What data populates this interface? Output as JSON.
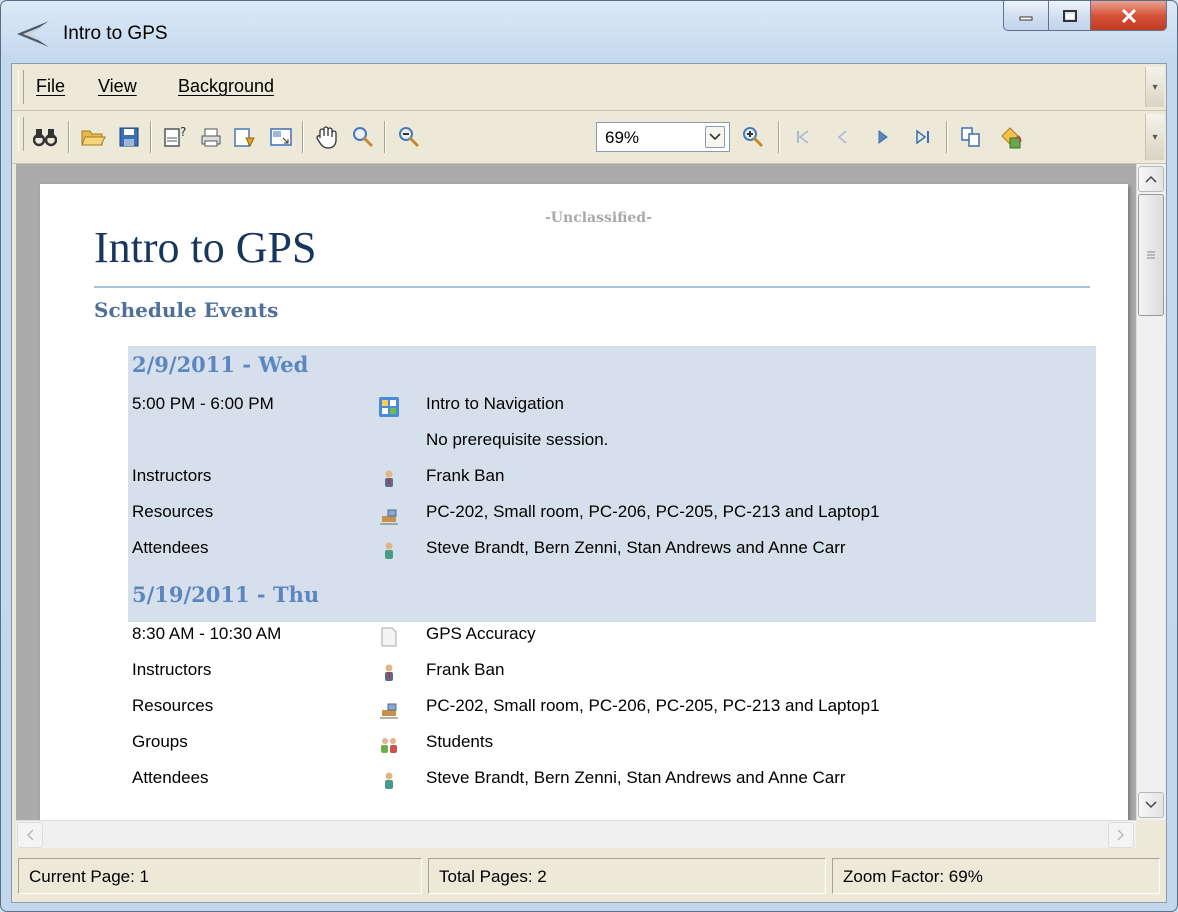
{
  "window": {
    "title": "Intro to GPS"
  },
  "menu": {
    "items": [
      "File",
      "View",
      "Background"
    ]
  },
  "toolbar": {
    "zoom_value": "69%",
    "icons": [
      "find",
      "open",
      "save",
      "page-setup",
      "print",
      "export",
      "fit-page",
      "hand-tool",
      "zoom-tool",
      "zoom-out",
      "zoom-in",
      "first-page",
      "previous-page",
      "next-page",
      "last-page",
      "multiple-pages",
      "background-color"
    ]
  },
  "document": {
    "classification": "-Unclassified-",
    "title": "Intro to GPS",
    "section_heading": "Schedule Events",
    "events": [
      {
        "date": "2/9/2011 - Wed",
        "time": "5:00 PM - 6:00 PM",
        "subject": "Intro to Navigation",
        "note": "No prerequisite session.",
        "instructors_label": "Instructors",
        "instructors": "Frank Ban",
        "resources_label": "Resources",
        "resources": "PC-202, Small room, PC-206, PC-205, PC-213 and Laptop1",
        "attendees_label": "Attendees",
        "attendees": "Steve Brandt, Bern Zenni, Stan Andrews and Anne Carr"
      },
      {
        "date": "5/19/2011 - Thu",
        "time": "8:30 AM - 10:30 AM",
        "subject": "GPS Accuracy",
        "instructors_label": "Instructors",
        "instructors": "Frank Ban",
        "resources_label": "Resources",
        "resources": "PC-202, Small room, PC-206, PC-205, PC-213 and Laptop1",
        "groups_label": "Groups",
        "groups": "Students",
        "attendees_label": "Attendees",
        "attendees": "Steve Brandt, Bern Zenni, Stan Andrews and Anne Carr"
      }
    ]
  },
  "status": {
    "current_page": "Current Page: 1",
    "total_pages": "Total Pages: 2",
    "zoom_factor": "Zoom Factor: 69%"
  },
  "colors": {
    "title": "#17365d",
    "date_heading": "#5b86c0",
    "event_highlight": "#d6e0ec",
    "section_heading": "#4f6f9c"
  }
}
